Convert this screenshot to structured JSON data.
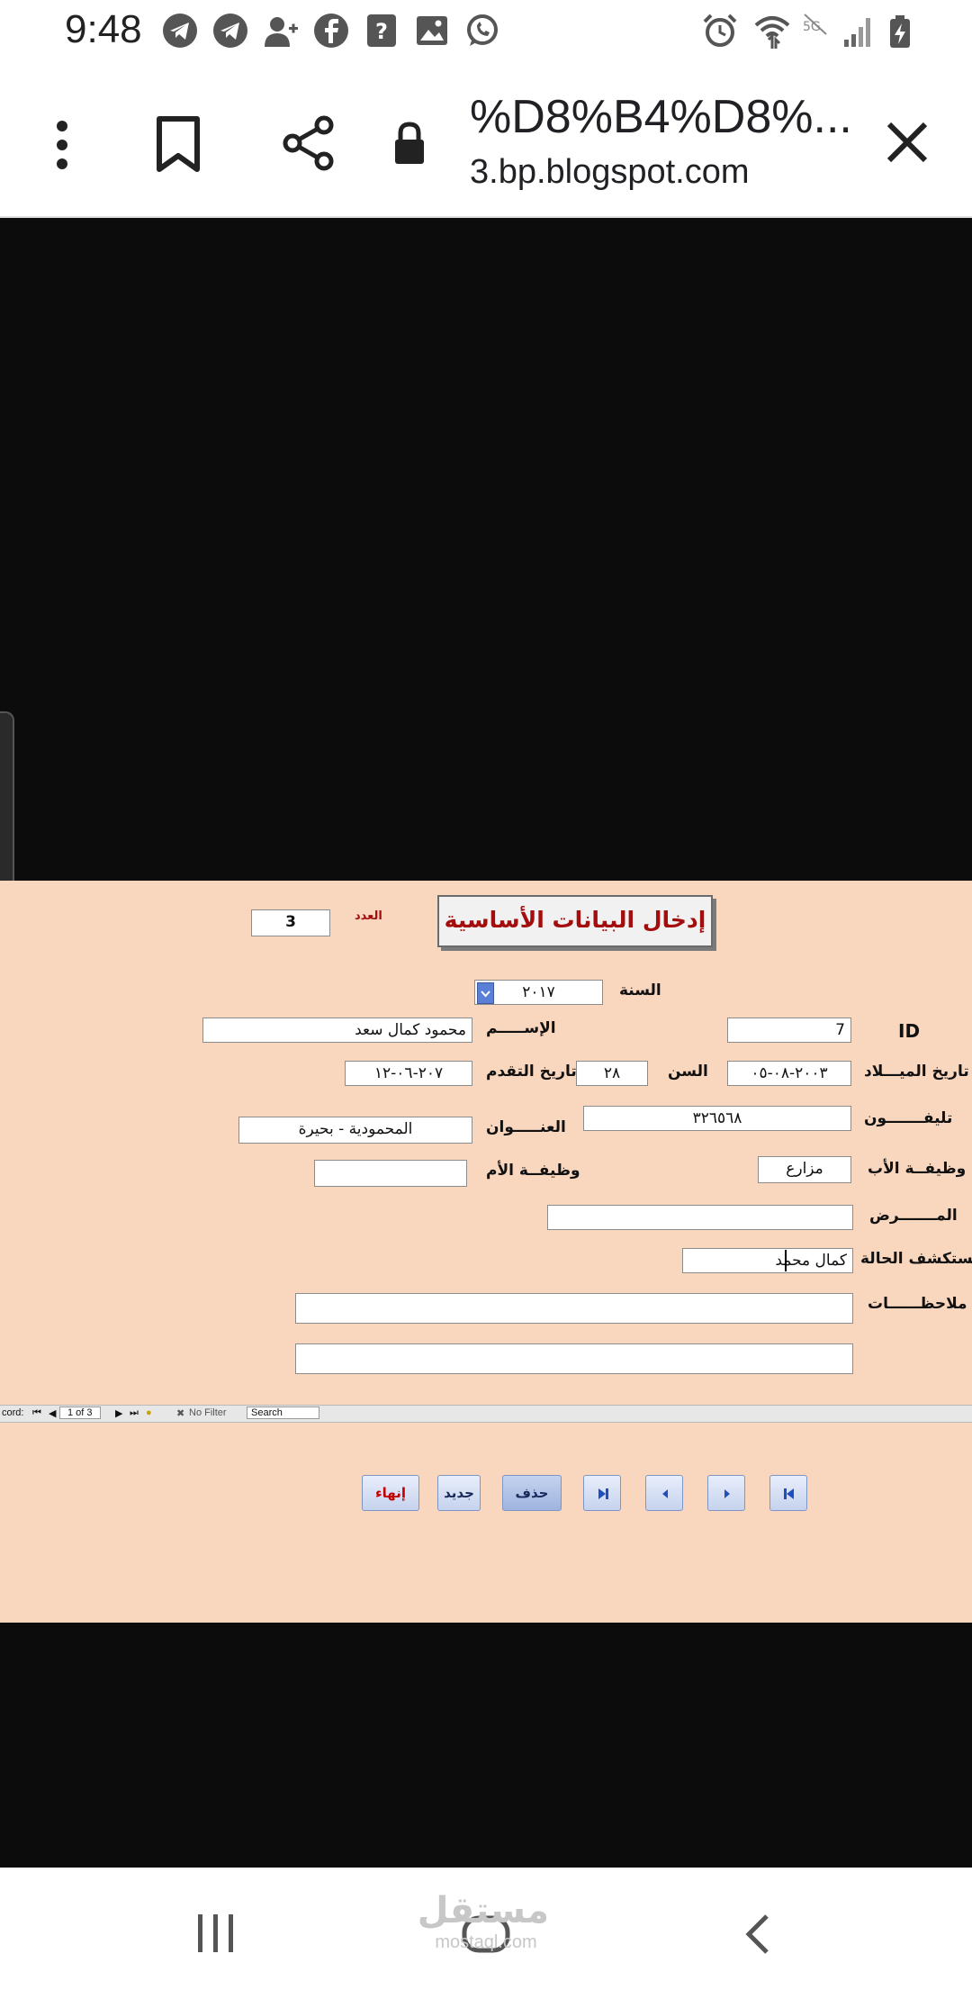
{
  "status_bar": {
    "time": "9:48",
    "notification_icons": [
      "telegram-icon",
      "telegram-icon",
      "add-contact-icon",
      "facebook-icon",
      "help-icon",
      "image-icon",
      "whatsapp-icon"
    ],
    "system_icons": [
      "alarm-icon",
      "wifi-icon",
      "network-off-icon",
      "signal-icon",
      "battery-charging-icon"
    ]
  },
  "browser": {
    "page_title": "%D8%B4%D8%...",
    "domain": "3.bp.blogspot.com",
    "icons": [
      "more-options-icon",
      "bookmark-icon",
      "share-icon",
      "lock-icon",
      "close-icon"
    ]
  },
  "form": {
    "title": "إدخال البيانات الأساسية",
    "count_label": "العدد",
    "count_value": "3",
    "year_label": "السنة",
    "year_value": "٢٠١٧",
    "id_label": "ID",
    "id_value": "7",
    "name_label": "الإســـــم",
    "name_value": "محمود كمال سعد",
    "birth_label": "تاريخ الميـــلاد",
    "birth_value": "٢٠٠٣-٠٨-٠٥",
    "age_label": "السن",
    "age_value": "٢٨",
    "apply_date_label": "تاريخ التقدم",
    "apply_date_value": "٢٠٧-٠٦-١٢",
    "phone_label": "تليفـــــــون",
    "phone_value": "٣٢٦٥٦٨",
    "address_label": "العنـــــوان",
    "address_value": "المحمودية - بحيرة",
    "father_job_label": "وظيفــة الأب",
    "father_job_value": "مزارع",
    "mother_job_label": "وظيفــة الأم",
    "mother_job_value": "",
    "disease_label": "المـــــــرض",
    "disease_value": "",
    "discoverer_label": "مستكشف الحالة",
    "discoverer_value": "كمال محمد",
    "notes_label": "ملاحظــــــات",
    "notes_value_1": "",
    "notes_value_2": ""
  },
  "buttons": {
    "finish_label": "إنهاء",
    "new_label": "جديد",
    "delete_label": "حذف",
    "finish_color": "#c00000",
    "nav_icons": [
      "last-record-icon",
      "previous-record-icon",
      "next-record-icon",
      "first-record-icon"
    ]
  },
  "record_bar": {
    "record_label": "cord:",
    "position": "1 of 3",
    "filter": "No Filter",
    "search": "Search"
  },
  "colors": {
    "form_background": "#f9d6be",
    "title_text": "#a30d0d",
    "content_background": "#0c0c0c"
  },
  "watermark": {
    "line1": "مستقل",
    "line2": "mostaql.com"
  },
  "nav_bar": {
    "icons": [
      "recent-apps-icon",
      "home-icon",
      "back-icon"
    ]
  }
}
